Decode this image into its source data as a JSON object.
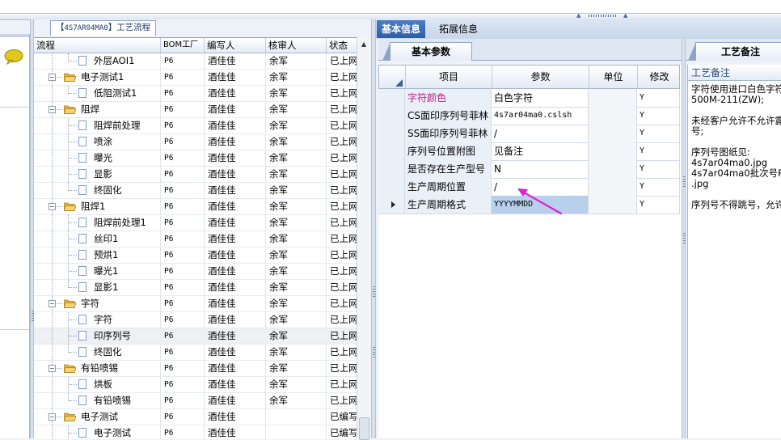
{
  "flow_panel": {
    "tab_prefix": "【",
    "tab_code": "4S7AR04MA0",
    "tab_suffix": "】工艺流程",
    "columns": [
      "流程",
      "BOM工厂",
      "编写人",
      "核审人",
      "状态"
    ],
    "rows": [
      {
        "level": 2,
        "type": "doc",
        "name": "外层AOI1",
        "bom": "P6",
        "author": "酒佳佳",
        "reviewer": "余军",
        "status": "已上网"
      },
      {
        "level": 1,
        "type": "folder",
        "name": "电子测试1",
        "bom": "P6",
        "author": "酒佳佳",
        "reviewer": "余军",
        "status": "已上网"
      },
      {
        "level": 2,
        "type": "doc",
        "name": "低阻测试1",
        "bom": "P6",
        "author": "酒佳佳",
        "reviewer": "余军",
        "status": "已上网"
      },
      {
        "level": 1,
        "type": "folder",
        "name": "阻焊",
        "bom": "P6",
        "author": "酒佳佳",
        "reviewer": "余军",
        "status": "已上网"
      },
      {
        "level": 2,
        "type": "doc",
        "name": "阻焊前处理",
        "bom": "P6",
        "author": "酒佳佳",
        "reviewer": "余军",
        "status": "已上网"
      },
      {
        "level": 2,
        "type": "doc",
        "name": "喷涂",
        "bom": "P6",
        "author": "酒佳佳",
        "reviewer": "余军",
        "status": "已上网"
      },
      {
        "level": 2,
        "type": "doc",
        "name": "曝光",
        "bom": "P6",
        "author": "酒佳佳",
        "reviewer": "余军",
        "status": "已上网"
      },
      {
        "level": 2,
        "type": "doc",
        "name": "显影",
        "bom": "P6",
        "author": "酒佳佳",
        "reviewer": "余军",
        "status": "已上网"
      },
      {
        "level": 2,
        "type": "doc",
        "name": "终固化",
        "bom": "P6",
        "author": "酒佳佳",
        "reviewer": "余军",
        "status": "已上网"
      },
      {
        "level": 1,
        "type": "folder",
        "name": "阻焊1",
        "bom": "P6",
        "author": "酒佳佳",
        "reviewer": "余军",
        "status": "已上网"
      },
      {
        "level": 2,
        "type": "doc",
        "name": "阻焊前处理1",
        "bom": "P6",
        "author": "酒佳佳",
        "reviewer": "余军",
        "status": "已上网"
      },
      {
        "level": 2,
        "type": "doc",
        "name": "丝印1",
        "bom": "P6",
        "author": "酒佳佳",
        "reviewer": "余军",
        "status": "已上网"
      },
      {
        "level": 2,
        "type": "doc",
        "name": "预烘1",
        "bom": "P6",
        "author": "酒佳佳",
        "reviewer": "余军",
        "status": "已上网"
      },
      {
        "level": 2,
        "type": "doc",
        "name": "曝光1",
        "bom": "P6",
        "author": "酒佳佳",
        "reviewer": "余军",
        "status": "已上网"
      },
      {
        "level": 2,
        "type": "doc",
        "name": "显影1",
        "bom": "P6",
        "author": "酒佳佳",
        "reviewer": "余军",
        "status": "已上网"
      },
      {
        "level": 1,
        "type": "folder",
        "name": "字符",
        "bom": "P6",
        "author": "酒佳佳",
        "reviewer": "余军",
        "status": "已上网"
      },
      {
        "level": 2,
        "type": "doc",
        "name": "字符",
        "bom": "P6",
        "author": "酒佳佳",
        "reviewer": "余军",
        "status": "已上网"
      },
      {
        "level": 2,
        "type": "doc",
        "name": "印序列号",
        "bom": "P6",
        "author": "酒佳佳",
        "reviewer": "余军",
        "status": "已上网",
        "selected": true
      },
      {
        "level": 2,
        "type": "doc",
        "name": "终固化",
        "bom": "P6",
        "author": "酒佳佳",
        "reviewer": "余军",
        "status": "已上网"
      },
      {
        "level": 1,
        "type": "folder",
        "name": "有铅喷锡",
        "bom": "P6",
        "author": "酒佳佳",
        "reviewer": "余军",
        "status": "已上网"
      },
      {
        "level": 2,
        "type": "doc",
        "name": "烘板",
        "bom": "P6",
        "author": "酒佳佳",
        "reviewer": "余军",
        "status": "已上网"
      },
      {
        "level": 2,
        "type": "doc",
        "name": "有铅喷锡",
        "bom": "P6",
        "author": "酒佳佳",
        "reviewer": "余军",
        "status": "已上网"
      },
      {
        "level": 1,
        "type": "folder",
        "name": "电子测试",
        "bom": "P6",
        "author": "酒佳佳",
        "reviewer": "",
        "status": "已编写"
      },
      {
        "level": 2,
        "type": "doc",
        "name": "电子测试",
        "bom": "P6",
        "author": "酒佳佳",
        "reviewer": "",
        "status": "已编写"
      },
      {
        "level": 2,
        "type": "doc",
        "name": "低阻测试",
        "bom": "P6",
        "author": "酒佳佳",
        "reviewer": "余军",
        "status": "已上网"
      }
    ]
  },
  "info_tabs": [
    "基本信息",
    "拓展信息"
  ],
  "subtab": "基本参数",
  "params": {
    "columns": [
      "项目",
      "参数",
      "单位",
      "修改"
    ],
    "rows": [
      {
        "item": "字符颜色",
        "value": "白色字符",
        "unit": "",
        "modified": "Y",
        "highlight": true
      },
      {
        "item": "CS面印序列号菲林",
        "value": "4s7ar04ma0.cslsh",
        "unit": "",
        "modified": "Y",
        "mono": true
      },
      {
        "item": "SS面印序列号菲林",
        "value": "/",
        "unit": "",
        "modified": "Y"
      },
      {
        "item": "序列号位置附图",
        "value": "见备注",
        "unit": "",
        "modified": "Y"
      },
      {
        "item": "是否存在生产型号",
        "value": "N",
        "unit": "",
        "modified": "Y"
      },
      {
        "item": "生产周期位置",
        "value": "/",
        "unit": "",
        "modified": "Y"
      },
      {
        "item": "生产周期格式",
        "value": "YYYYMMDD",
        "unit": "",
        "modified": "Y",
        "selected": true,
        "mono": true
      }
    ]
  },
  "notes": {
    "tab": "工艺备注",
    "header": "工艺备注",
    "body": "字符使用进口白色字符\n500M-211(ZW);\n\n未经客户允许不允许露\n号;\n\n序列号图纸见:\n4s7ar04ma0.jpg\n4s7ar04ma0批次号PN\n.jpg\n\n序列号不得跳号，允许"
  },
  "colors": {
    "accent_tab": "#2e5ea6",
    "highlight_text": "#c0208a",
    "arrow": "#e020d0"
  }
}
